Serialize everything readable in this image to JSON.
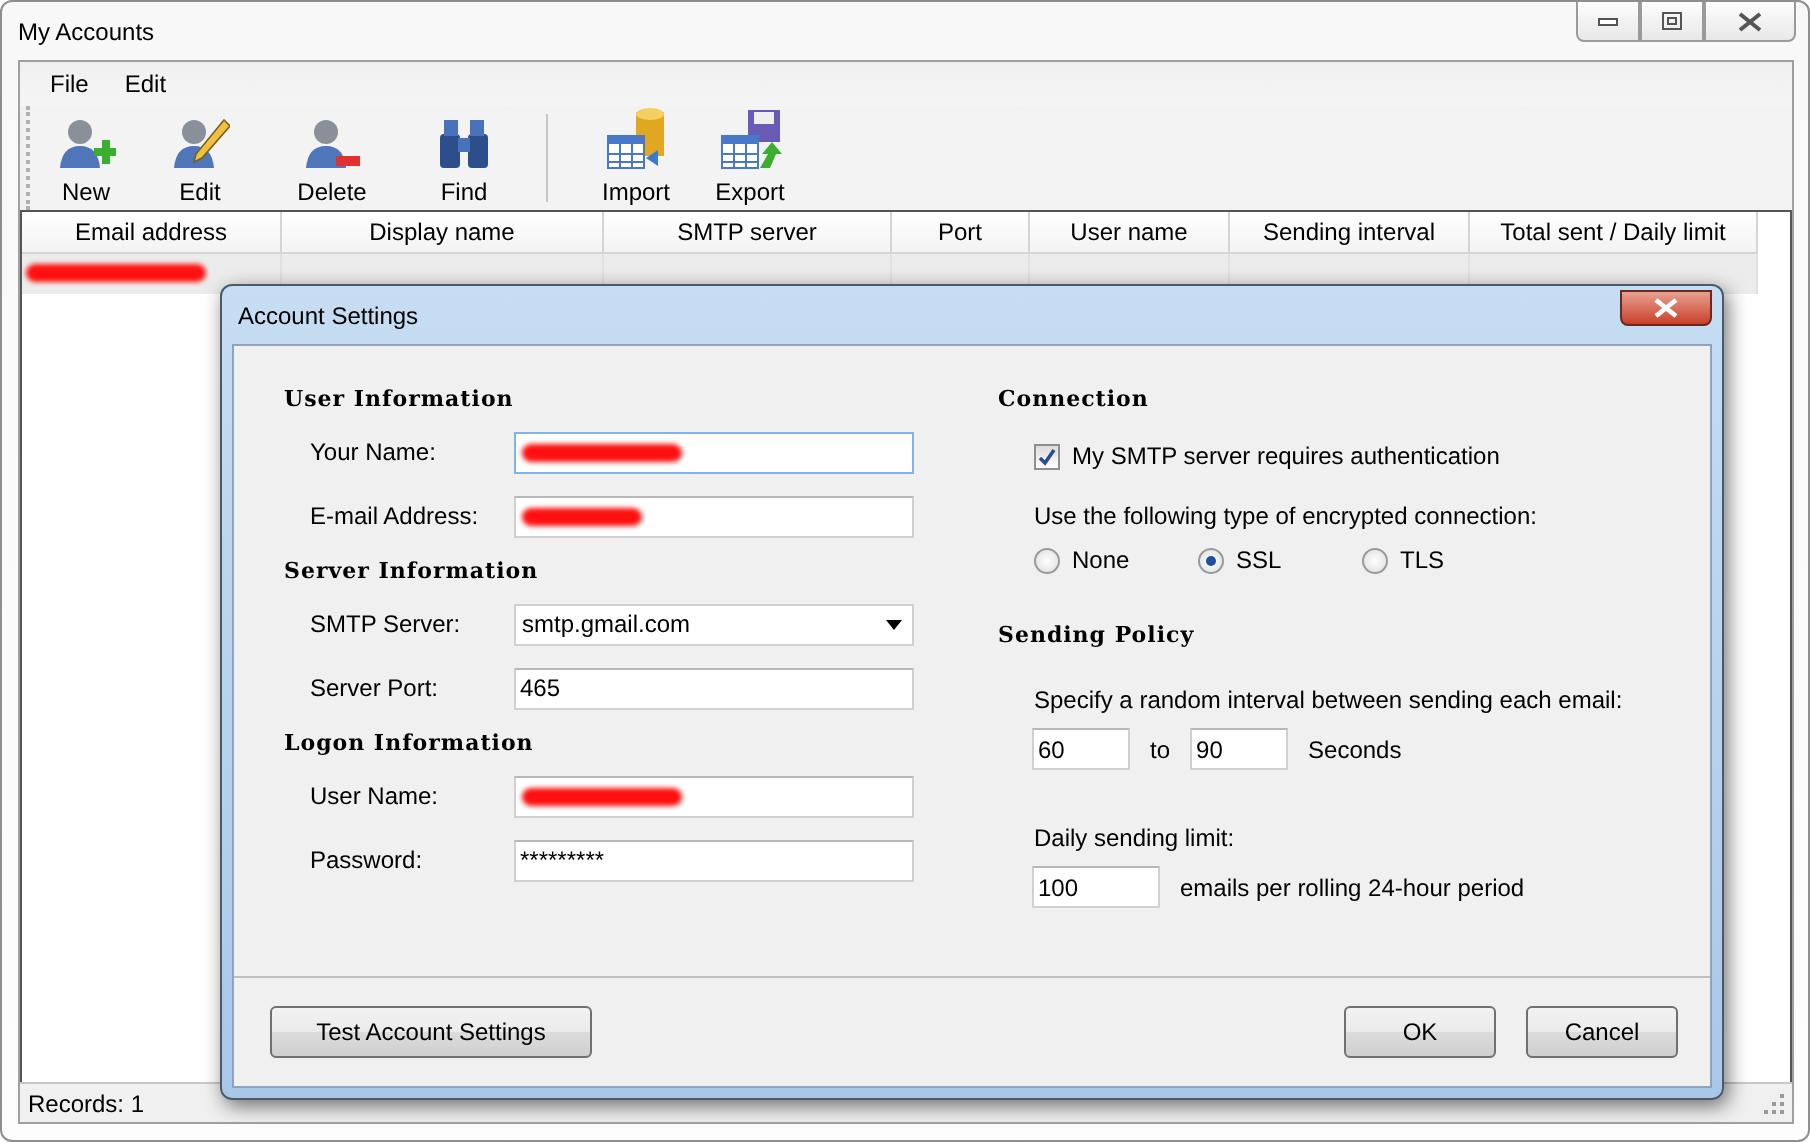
{
  "window": {
    "title": "My Accounts"
  },
  "menu": [
    {
      "label": "File"
    },
    {
      "label": "Edit"
    }
  ],
  "toolbar": [
    [
      {
        "label": "New",
        "kind": "user-add"
      },
      {
        "label": "Edit",
        "kind": "user-edit"
      },
      {
        "label": "Delete",
        "kind": "user-remove"
      },
      {
        "label": "Find",
        "kind": "find"
      }
    ],
    [
      {
        "label": "Import",
        "kind": "import"
      },
      {
        "label": "Export",
        "kind": "export"
      }
    ]
  ],
  "table": {
    "columns": [
      "Email address",
      "Display name",
      "SMTP server",
      "Port",
      "User name",
      "Sending interval",
      "Total sent / Daily limit"
    ],
    "rows": [
      {
        "selected": true,
        "email_redacted": true
      }
    ]
  },
  "status_bar": {
    "text": "Records: 1"
  },
  "dialog": {
    "title": "Account Settings",
    "left_sections": [
      {
        "title": "User Information",
        "fields": [
          {
            "label": "Your Name:",
            "kind": "text",
            "redacted": true,
            "focused": true
          },
          {
            "label": "E-mail Address:",
            "kind": "text",
            "redacted": true,
            "focused": false
          }
        ]
      },
      {
        "title": "Server Information",
        "fields": [
          {
            "label": "SMTP Server:",
            "kind": "dropdown",
            "value": "smtp.gmail.com",
            "focused": false
          },
          {
            "label": "Server Port:",
            "kind": "text",
            "value": "465",
            "focused": false
          }
        ]
      },
      {
        "title": "Logon Information",
        "fields": [
          {
            "label": "User Name:",
            "kind": "text",
            "redacted": true,
            "focused": false
          },
          {
            "label": "Password:",
            "kind": "text",
            "value": "*********",
            "focused": false
          }
        ]
      }
    ],
    "connection": {
      "title": "Connection",
      "auth": {
        "label": "My SMTP server requires authentication",
        "checked": true
      },
      "encryption_label": "Use the following type of encrypted connection:",
      "encryption": [
        {
          "label": "None",
          "selected": false
        },
        {
          "label": "SSL",
          "selected": true
        },
        {
          "label": "TLS",
          "selected": false
        }
      ]
    },
    "policy": {
      "title": "Sending Policy",
      "interval_label": "Specify a random interval between sending each email:",
      "interval_from": "60",
      "interval_to_label": "to",
      "interval_to": "90",
      "interval_unit": "Seconds",
      "limit_label": "Daily sending limit:",
      "limit": "100",
      "limit_unit": "emails per rolling 24-hour period"
    },
    "left_buttons": [
      "Test Account Settings"
    ],
    "right_buttons": [
      "OK",
      "Cancel"
    ]
  }
}
